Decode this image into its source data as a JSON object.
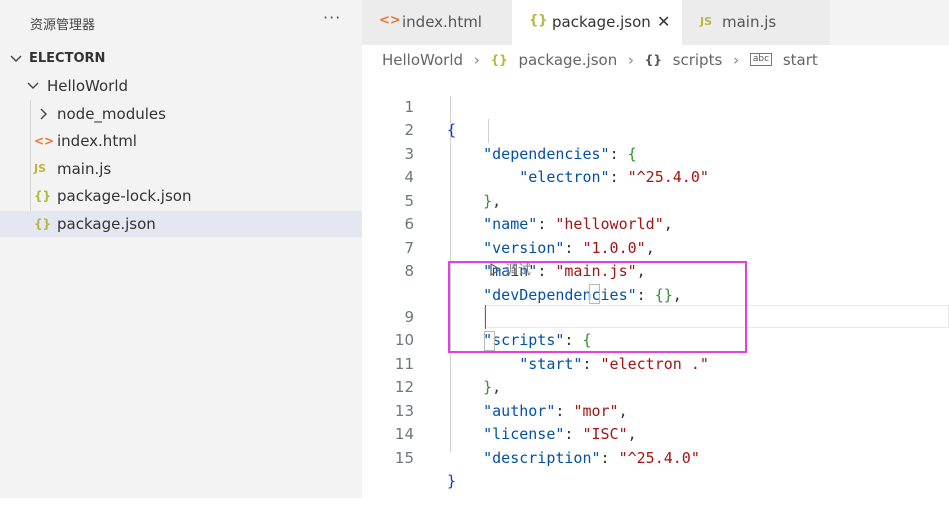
{
  "sidebar": {
    "title": "资源管理器",
    "more": "···",
    "root": "ELECTORN",
    "folder": "HelloWorld",
    "items": [
      {
        "label": "node_modules",
        "icon": "chevron-right-icon"
      },
      {
        "label": "index.html",
        "icon": "html-file-icon",
        "glyph": "<>"
      },
      {
        "label": "main.js",
        "icon": "js-file-icon",
        "glyph": "JS"
      },
      {
        "label": "package-lock.json",
        "icon": "json-file-icon",
        "glyph": "{}"
      },
      {
        "label": "package.json",
        "icon": "json-file-icon",
        "glyph": "{}"
      }
    ]
  },
  "tabs": [
    {
      "label": "index.html",
      "glyph": "<>",
      "icon": "html-file-icon"
    },
    {
      "label": "package.json",
      "glyph": "{}",
      "icon": "json-file-icon",
      "close": "✕"
    },
    {
      "label": "main.js",
      "glyph": "JS",
      "icon": "js-file-icon"
    }
  ],
  "breadcrumb": {
    "folder": "HelloWorld",
    "file": "package.json",
    "file_glyph": "{}",
    "section": "scripts",
    "section_glyph": "{}",
    "leaf": "start",
    "leaf_glyph": "abc"
  },
  "codelens": "调试",
  "lines": {
    "n": [
      "1",
      "2",
      "3",
      "4",
      "5",
      "6",
      "7",
      "8",
      "9",
      "10",
      "11",
      "12",
      "13",
      "14",
      "15"
    ],
    "l1": "{",
    "l2": {
      "k": "\"dependencies\"",
      "p": ": ",
      "b": "{"
    },
    "l3": {
      "k": "\"electron\"",
      "p": ": ",
      "v": "\"^25.4.0\""
    },
    "l4": {
      "b": "}",
      "p": ","
    },
    "l5": {
      "k": "\"name\"",
      "p": ": ",
      "v": "\"helloworld\"",
      "c": ","
    },
    "l6": {
      "k": "\"version\"",
      "p": ": ",
      "v": "\"1.0.0\"",
      "c": ","
    },
    "l7": {
      "k": "\"main\"",
      "p": ": ",
      "v": "\"main.js\"",
      "c": ","
    },
    "l8": {
      "k": "\"devDependencies\"",
      "p": ": ",
      "b": "{}",
      "c": ","
    },
    "l9": {
      "k": "\"scripts\"",
      "p": ": ",
      "b": "{"
    },
    "l10": {
      "k": "\"start\"",
      "p": ": ",
      "v": "\"electron .\""
    },
    "l11": {
      "b": "}",
      "p": ","
    },
    "l12": {
      "k": "\"author\"",
      "p": ": ",
      "v": "\"mor\"",
      "c": ","
    },
    "l13": {
      "k": "\"license\"",
      "p": ": ",
      "v": "\"ISC\"",
      "c": ","
    },
    "l14": {
      "k": "\"description\"",
      "p": ": ",
      "v": "\"^25.4.0\""
    },
    "l15": "}"
  },
  "colors": {
    "key": "#0451a5",
    "string": "#a31515",
    "bracket_level1": "#0431fa",
    "bracket_level2": "#319331",
    "highlight": "#e040e0",
    "html_icon": "#e37933",
    "js_icon": "#cbcb41",
    "json_icon": "#cbcb41"
  }
}
